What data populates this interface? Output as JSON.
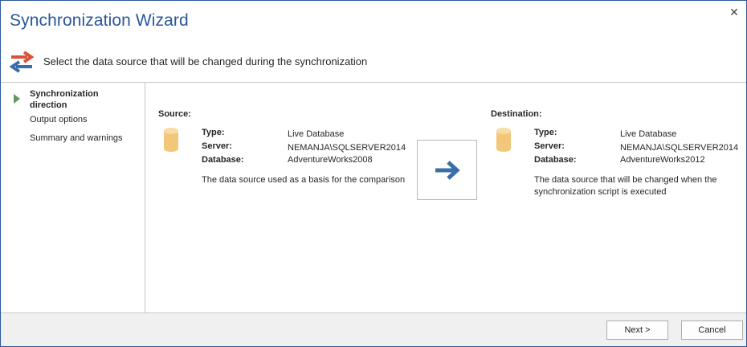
{
  "window": {
    "title": "Synchronization Wizard",
    "close_glyph": "✕",
    "subtitle": "Select the data source that will be changed during the synchronization",
    "subtitle_icon": "sync-arrows-icon"
  },
  "sidebar": {
    "steps": [
      {
        "label": "Synchronization direction",
        "active": true
      },
      {
        "label": "Output options",
        "active": false
      },
      {
        "label": "Summary and warnings",
        "active": false
      }
    ]
  },
  "source": {
    "heading": "Source:",
    "type_label": "Type:",
    "type_value": "Live Database",
    "server_label": "Server:",
    "server_value": "NEMANJA\\SQLSERVER2014",
    "database_label": "Database:",
    "database_value": "AdventureWorks2008",
    "description": "The data source used as a basis for the comparison"
  },
  "destination": {
    "heading": "Destination:",
    "type_label": "Type:",
    "type_value": "Live Database",
    "server_label": "Server:",
    "server_value": "NEMANJA\\SQLSERVER2014",
    "database_label": "Database:",
    "database_value": "AdventureWorks2012",
    "description": "The data source that will be changed when the synchronization script is executed"
  },
  "direction_button": {
    "icon": "arrow-right-icon"
  },
  "footer": {
    "next_label": "Next >",
    "cancel_label": "Cancel"
  },
  "colors": {
    "title": "#2b579a",
    "arrow": "#3a6ea8",
    "db_icon": "#f2c77a",
    "step_marker": "#5f9b5c",
    "icon_red": "#d9533c",
    "icon_blue": "#3a6ea8"
  }
}
